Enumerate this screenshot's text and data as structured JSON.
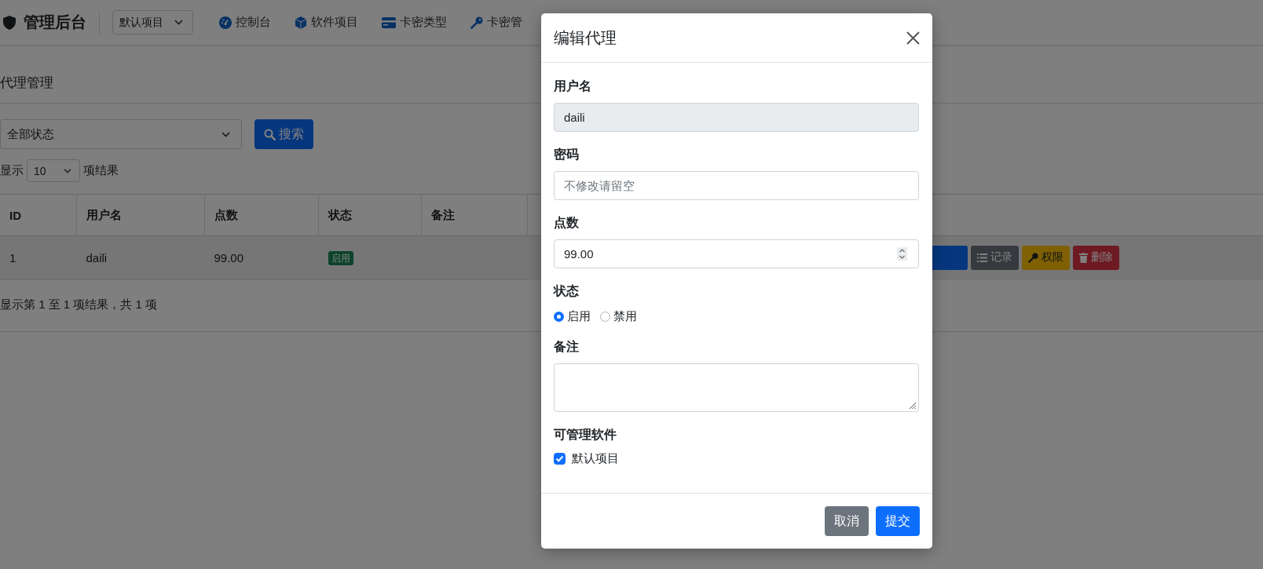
{
  "navbar": {
    "brand": "管理后台",
    "project_select": "默认项目",
    "items": [
      {
        "label": "控制台",
        "kind": "dashboard"
      },
      {
        "label": "软件项目",
        "kind": "box"
      },
      {
        "label": "卡密类型",
        "kind": "card"
      },
      {
        "label": "卡密管",
        "kind": "key"
      }
    ]
  },
  "page": {
    "title": "代理管理",
    "status_select": "全部状态",
    "search_button": "搜索",
    "length": {
      "prefix": "显示",
      "value": "10",
      "suffix": "项结果"
    },
    "table": {
      "columns": [
        "ID",
        "用户名",
        "点数",
        "状态",
        "备注"
      ],
      "rows": [
        {
          "id": "1",
          "username": "daili",
          "points": "99.00",
          "status": "启用",
          "enabled": true,
          "actions": [
            {
              "kind": "edit"
            },
            {
              "kind": "log",
              "label": "记录"
            },
            {
              "kind": "perm",
              "label": "权限"
            },
            {
              "kind": "delete",
              "label": "删除"
            }
          ]
        }
      ]
    },
    "info": "显示第 1 至 1 项结果，共 1 项"
  },
  "modal": {
    "title": "编辑代理",
    "fields": [
      {
        "kind": "readonly",
        "label": "用户名",
        "value": "daili"
      },
      {
        "kind": "password",
        "label": "密码",
        "placeholder": "不修改请留空"
      },
      {
        "kind": "number",
        "label": "点数",
        "value": "99.00"
      },
      {
        "kind": "radio",
        "label": "状态",
        "options": [
          {
            "label": "启用",
            "selected": true
          },
          {
            "label": "禁用",
            "selected": false
          }
        ]
      },
      {
        "kind": "textarea",
        "label": "备注"
      },
      {
        "kind": "checkboxes",
        "label": "可管理软件",
        "options": [
          {
            "label": "默认项目",
            "checked": true
          }
        ]
      }
    ],
    "buttons": [
      {
        "kind": "cancel",
        "label": "取消"
      },
      {
        "kind": "submit",
        "label": "提交"
      }
    ]
  }
}
